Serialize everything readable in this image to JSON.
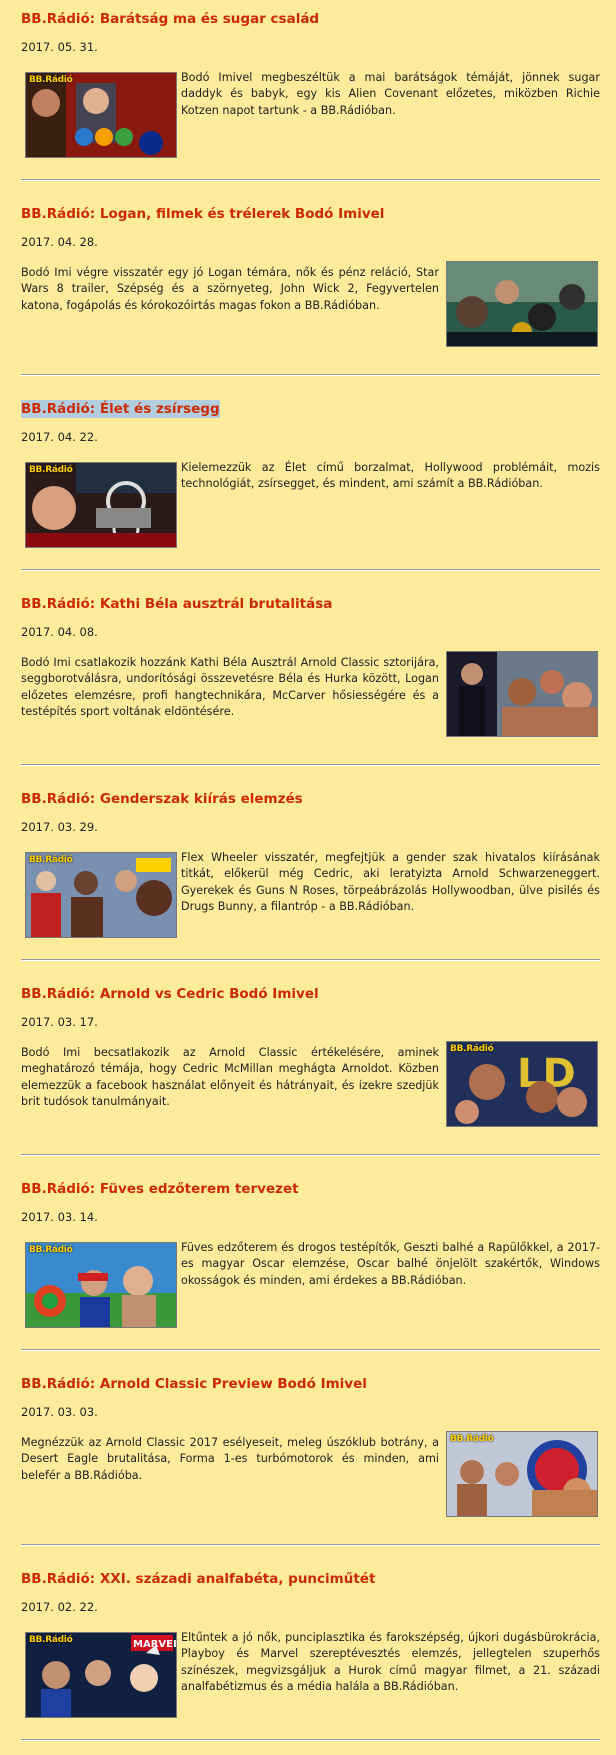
{
  "posts": [
    {
      "title": "BB.Rádió: Barátság ma és sugar család",
      "date": "2017. 05. 31.",
      "body": "Bodó Imivel megbeszéltük a mai barátságok témáját, jönnek sugar daddyk és babyk, egy kis Alien Covenant előzetes, miközben Richie Kotzen napot tartunk - a BB.Rádióban.",
      "image_side": "left",
      "highlighted": false,
      "logo_text": "BB.Rádió"
    },
    {
      "title": "BB.Rádió: Logan, filmek és trélerek Bodó Imivel",
      "date": "2017. 04. 28.",
      "body": "Bodó Imi végre visszatér egy jó Logan témára, nők és pénz reláció, Star Wars 8 trailer, Szépség és a szörnyeteg, John Wick 2, Fegyvertelen katona, fogápolás és kórokozóirtás magas fokon a BB.Rádióban.",
      "image_side": "right",
      "highlighted": false,
      "logo_text": ""
    },
    {
      "title": "BB.Rádió: Élet és zsírsegg",
      "date": "2017. 04. 22.",
      "body": "Kielemezzük az Élet című borzalmat, Hollywood problémáit, mozis technológiát, zsírsegget, és mindent, ami számít a BB.Rádióban.",
      "image_side": "left",
      "highlighted": true,
      "logo_text": "BB.Rádió"
    },
    {
      "title": "BB.Rádió: Kathi Béla ausztrál brutalitása",
      "date": "2017. 04. 08.",
      "body": "Bodó Imi csatlakozik hozzánk Kathi Béla Ausztrál Arnold Classic sztorijára, seggborotválásra, undorítósági összevetésre Béla és Hurka között, Logan előzetes elemzésre, profi hangtechnikára, McCarver hősiességére és a testépítés sport voltának eldöntésére.",
      "image_side": "right",
      "highlighted": false,
      "logo_text": ""
    },
    {
      "title": "BB.Rádió: Genderszak kiírás elemzés",
      "date": "2017. 03. 29.",
      "body": "Flex Wheeler visszatér, megfejtjük a gender szak hivatalos kiírásának titkát, előkerül még Cedric, aki leratyizta Arnold Schwarzeneggert. Gyerekek és Guns N Roses, törpeábrázolás Hollywoodban, ülve pisilés és Drugs Bunny, a filantróp - a BB.Rádióban.",
      "image_side": "left",
      "highlighted": false,
      "logo_text": "BB.Rádió"
    },
    {
      "title": "BB.Rádió: Arnold vs Cedric Bodó Imivel",
      "date": "2017. 03. 17.",
      "body": "Bodó Imi becsatlakozik az Arnold Classic értékelésére, aminek meghatározó témája, hogy Cedric McMillan meghágta Arnoldot. Közben elemezzük a facebook használat előnyeit és hátrányait, és ízekre szedjük brit tudósok tanulmányait.",
      "image_side": "right",
      "highlighted": false,
      "logo_text": "BB.Rádió"
    },
    {
      "title": "BB.Rádió: Füves edzőterem tervezet",
      "date": "2017. 03. 14.",
      "body": "Füves edzőterem és drogos testépítők, Geszti balhé a Rapülőkkel, a 2017-es magyar Oscar elemzése, Oscar balhé önjelölt szakértők, Windows okosságok és minden, ami érdekes a BB.Rádióban.",
      "image_side": "left",
      "highlighted": false,
      "logo_text": "BB.Rádió"
    },
    {
      "title": "BB.Rádió: Arnold Classic Preview Bodó Imivel",
      "date": "2017. 03. 03.",
      "body": "Megnézzük az Arnold Classic 2017 esélyeseit, meleg úszóklub botrány, a Desert Eagle brutalitása, Forma 1-es turbómotorok és minden, ami belefér a BB.Rádióba.",
      "image_side": "right",
      "highlighted": false,
      "logo_text": "BB.Rádió"
    },
    {
      "title": "BB.Rádió: XXI. századi analfabéta, punciműtét",
      "date": "2017. 02. 22.",
      "body": "Eltűntek a jó nők, punciplasztika és farokszépség, újkori dugásbürokrácia, Playboy és Marvel szereptévesztés elemzés, jellegtelen szuperhős színészek, megvizsgáljuk a Hurok című magyar filmet, a 21. századi analfabétizmus és a média halála a BB.Rádióban.",
      "image_side": "left",
      "highlighted": false,
      "logo_text": "BB.Rádió"
    }
  ],
  "colors": {
    "page_background": "#ffeb9c",
    "title": "#cc2a00",
    "highlight": "#b3cde0",
    "separator": "#9a9a9a"
  }
}
